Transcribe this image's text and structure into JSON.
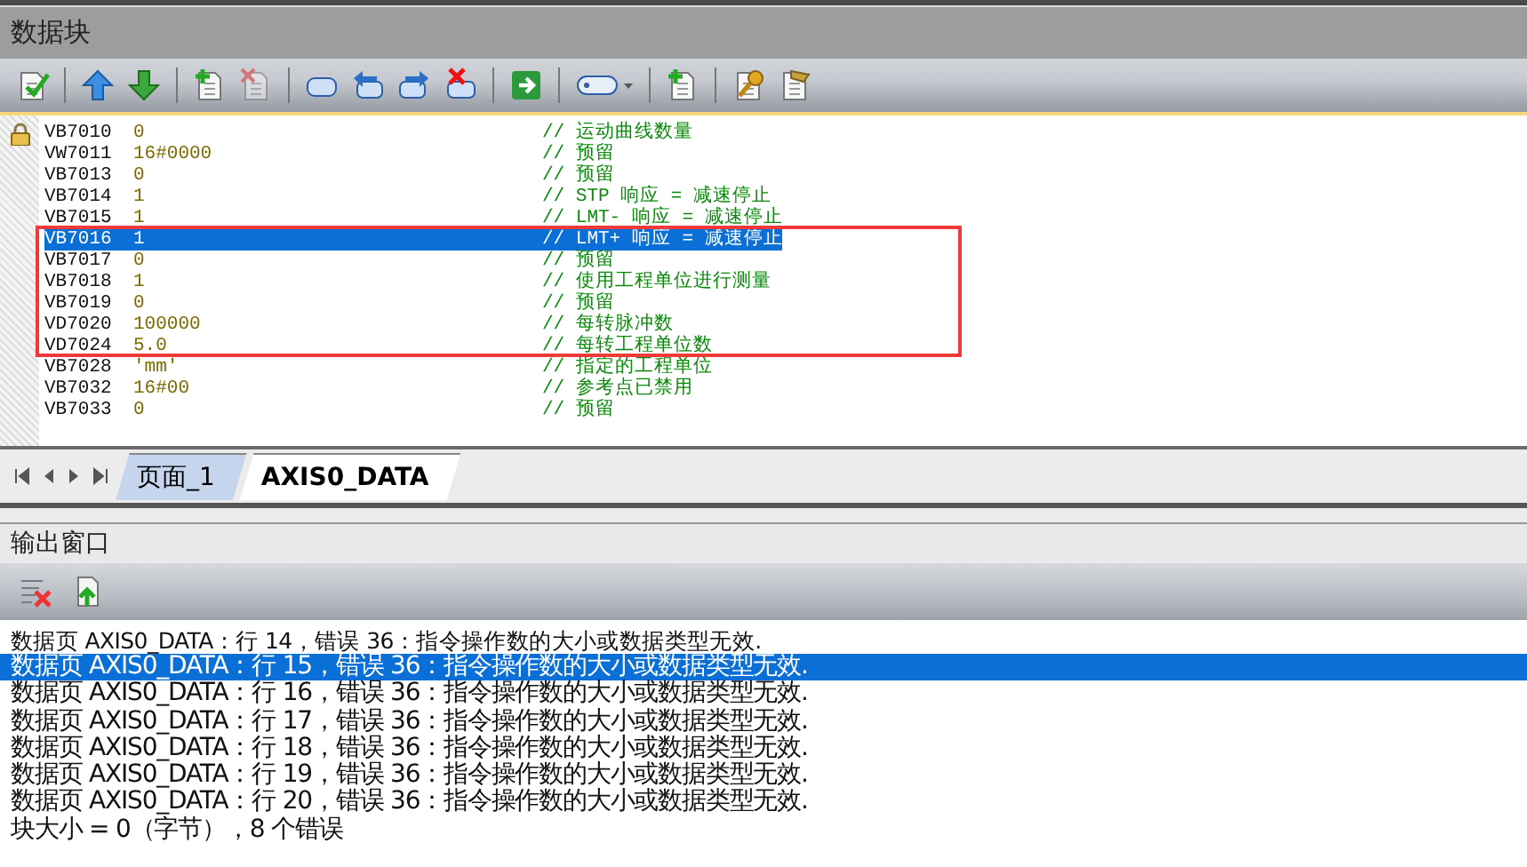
{
  "window": {
    "title": "数据块"
  },
  "editor": {
    "rows": [
      {
        "address": "VB7010",
        "value": "0",
        "comment": "// 运动曲线数量",
        "selected": false,
        "locked": true
      },
      {
        "address": "VW7011",
        "value": "16#0000",
        "comment": "// 预留",
        "selected": false,
        "locked": false
      },
      {
        "address": "VB7013",
        "value": "0",
        "comment": "// 预留",
        "selected": false,
        "locked": false
      },
      {
        "address": "VB7014",
        "value": "1",
        "comment": "// STP 响应 = 减速停止",
        "selected": false,
        "locked": false
      },
      {
        "address": "VB7015",
        "value": "1",
        "comment": "// LMT- 响应 = 减速停止",
        "selected": false,
        "locked": false
      },
      {
        "address": "VB7016",
        "value": "1",
        "comment": "// LMT+ 响应 = 减速停止",
        "selected": true,
        "locked": false
      },
      {
        "address": "VB7017",
        "value": "0",
        "comment": "// 预留",
        "selected": false,
        "locked": false
      },
      {
        "address": "VB7018",
        "value": "1",
        "comment": "// 使用工程单位进行测量",
        "selected": false,
        "locked": false
      },
      {
        "address": "VB7019",
        "value": "0",
        "comment": "// 预留",
        "selected": false,
        "locked": false
      },
      {
        "address": "VD7020",
        "value": "100000",
        "comment": "// 每转脉冲数",
        "selected": false,
        "locked": false
      },
      {
        "address": "VD7024",
        "value": "5.0",
        "comment": "// 每转工程单位数",
        "selected": false,
        "locked": false
      },
      {
        "address": "VB7028",
        "value": "'mm'",
        "comment": "// 指定的工程单位",
        "selected": false,
        "locked": false
      },
      {
        "address": "VB7032",
        "value": "16#00",
        "comment": "// 参考点已禁用",
        "selected": false,
        "locked": false
      },
      {
        "address": "VB7033",
        "value": "0",
        "comment": "// 预留",
        "selected": false,
        "locked": false
      }
    ]
  },
  "tabs": [
    {
      "label": "页面_1",
      "selected": false
    },
    {
      "label": "AXIS0_DATA",
      "selected": true
    }
  ],
  "output": {
    "title": "输出窗口",
    "lines": [
      {
        "text": "数据页 AXIS0_DATA：行 14，错误 36：指令操作数的大小或数据类型无效.",
        "kind": "small",
        "selected": false
      },
      {
        "text": "数据页 AXIS0_DATA：行 15，错误 36：指令操作数的大小或数据类型无效.",
        "kind": "large",
        "selected": true
      },
      {
        "text": "数据页 AXIS0_DATA：行 16，错误 36：指令操作数的大小或数据类型无效.",
        "kind": "large",
        "selected": false
      },
      {
        "text": "数据页 AXIS0_DATA：行 17，错误 36：指令操作数的大小或数据类型无效.",
        "kind": "large",
        "selected": false
      },
      {
        "text": "数据页 AXIS0_DATA：行 18，错误 36：指令操作数的大小或数据类型无效.",
        "kind": "large",
        "selected": false
      },
      {
        "text": "数据页 AXIS0_DATA：行 19，错误 36：指令操作数的大小或数据类型无效.",
        "kind": "large",
        "selected": false
      },
      {
        "text": "数据页 AXIS0_DATA：行 20，错误 36：指令操作数的大小或数据类型无效.",
        "kind": "large",
        "selected": false
      },
      {
        "text": "块大小 = 0（字节），8 个错误",
        "kind": "large",
        "selected": false
      }
    ]
  }
}
